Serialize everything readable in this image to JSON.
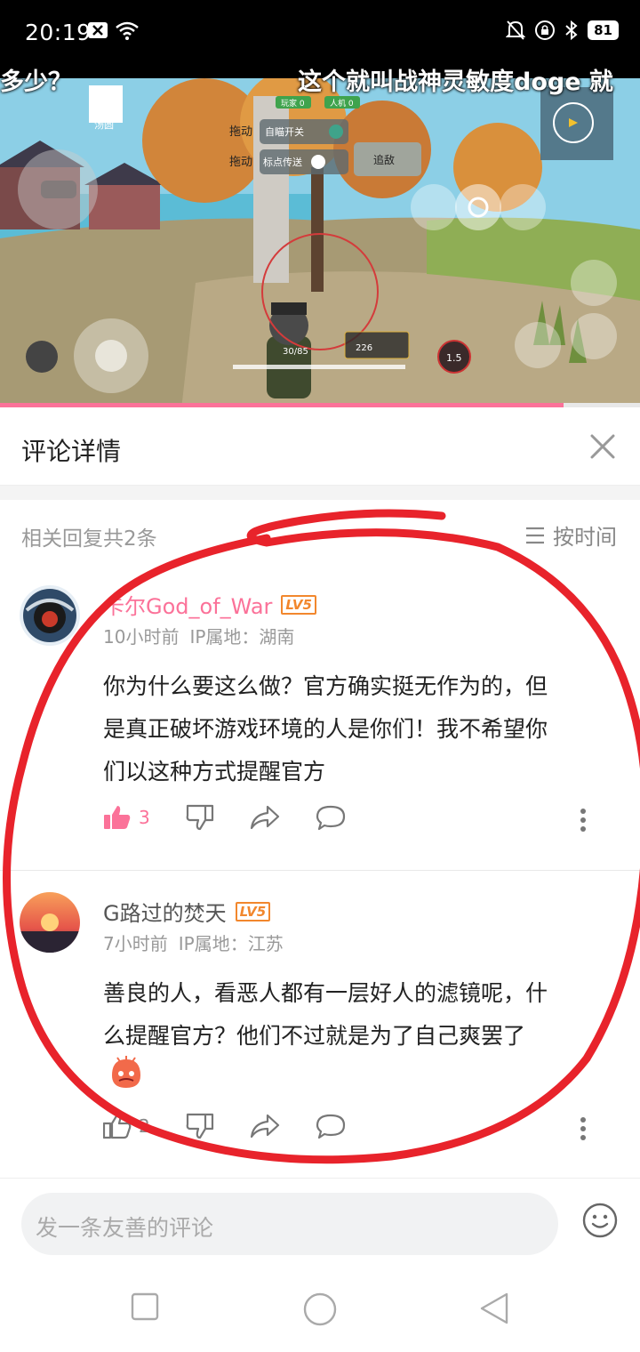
{
  "status_bar": {
    "time": "20:19",
    "battery": "81"
  },
  "video": {
    "danmaku_left": "多少？",
    "danmaku_right": "这个就叫战神灵敏度doge 就",
    "game_hud": {
      "drag_label_1": "拖动",
      "toggle_1_label": "自瞄开关",
      "drag_label_2": "拖动",
      "toggle_2_label": "标点传送",
      "chase_button": "追敌",
      "player_name": "汤圆",
      "player_count_label": "玩家",
      "player_count": "0",
      "bot_count_label": "人机",
      "bot_count": "0",
      "ammo": "30",
      "ammo_reserve": "85",
      "ammo_total": "226",
      "zoom_level": "1.5"
    },
    "progress_percent": 88
  },
  "comment_detail": {
    "title": "评论详情",
    "reply_count": "相关回复共2条",
    "sort_label": "按时间"
  },
  "comments": [
    {
      "username": "卡尔God_of_War",
      "username_color": "#fb7299",
      "level": "LV5",
      "time": "10小时前",
      "ip": "IP属地：湖南",
      "lines": [
        "你为什么要这么做？官方确实挺无作为的，但",
        "是真正破坏游戏环境的人是你们！我不希望你",
        "们以这种方式提醒官方"
      ],
      "likes": "3",
      "liked": true
    },
    {
      "username": "G路过的焚天",
      "username_color": "#555555",
      "level": "LV5",
      "time": "7小时前",
      "ip": "IP属地：江苏",
      "lines": [
        "善良的人，看恶人都有一层好人的滤镜呢，什",
        "么提醒官方？他们不过就是为了自己爽罢了"
      ],
      "likes": "2",
      "liked": false
    }
  ],
  "input": {
    "placeholder": "发一条友善的评论"
  },
  "colors": {
    "accent": "#fb7299",
    "level": "#f2872d",
    "annotation": "#e8232b"
  },
  "icons": [
    "close-icon",
    "sort-icon",
    "like-icon",
    "dislike-icon",
    "share-icon",
    "reply-icon",
    "more-icon",
    "emoji-icon",
    "nav-recent-icon",
    "nav-home-icon",
    "nav-back-icon"
  ]
}
